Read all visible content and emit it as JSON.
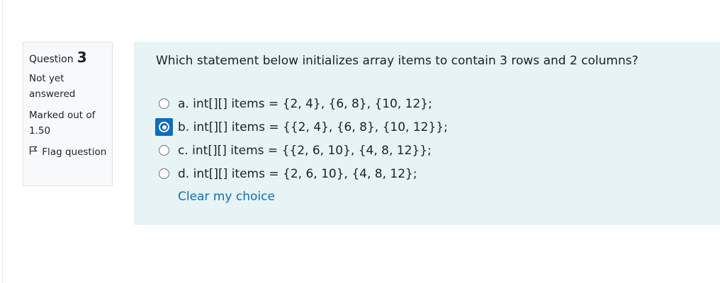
{
  "question_info": {
    "label": "Question",
    "number": "3",
    "state": "Not yet answered",
    "grade": "Marked out of 1.50",
    "flag_label": "Flag question"
  },
  "question": {
    "text": "Which statement below initializes array items to contain 3 rows and 2 columns?",
    "answers": [
      {
        "label": "a. int[][] items = {2, 4}, {6, 8}, {10, 12};",
        "selected": false
      },
      {
        "label": "b. int[][] items = {{2, 4}, {6, 8}, {10, 12}};",
        "selected": true
      },
      {
        "label": "c. int[][] items = {{2, 6, 10}, {4, 8, 12}};",
        "selected": false
      },
      {
        "label": "d. int[][] items = {2, 6, 10}, {4, 8, 12};",
        "selected": false
      }
    ],
    "clear_label": "Clear my choice"
  },
  "colors": {
    "accent": "#0f6cbf",
    "content_bg": "#e7f3f5",
    "info_bg": "#f8f9fa"
  },
  "icons": {
    "flag": "flag-icon",
    "radio": "radio-button"
  }
}
